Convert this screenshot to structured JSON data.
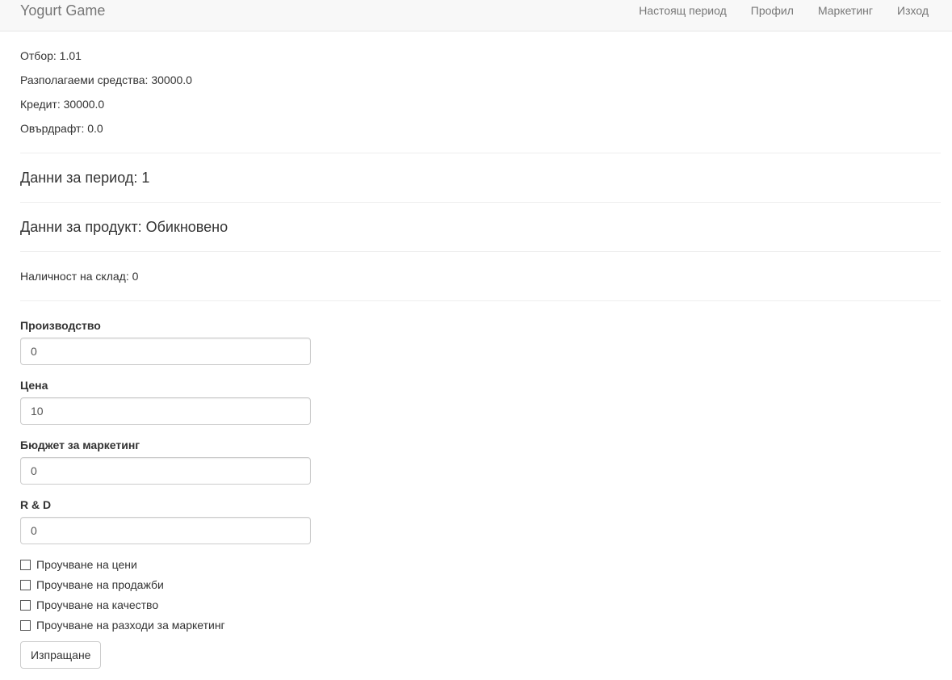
{
  "navbar": {
    "brand": "Yogurt Game",
    "links": [
      "Настоящ период",
      "Профил",
      "Маркетинг",
      "Изход"
    ]
  },
  "team_info": {
    "team": "Отбор: 1.01",
    "funds": "Разполагаеми средства: 30000.0",
    "credit": "Кредит: 30000.0",
    "overdraft": "Овърдрафт: 0.0"
  },
  "period_heading": "Данни за период: 1",
  "product_heading": "Данни за продукт: Обикновено",
  "stock": "Наличност на склад: 0",
  "form": {
    "production_label": "Производство",
    "production_value": "0",
    "price_label": "Цена",
    "price_value": "10",
    "marketing_label": "Бюджет за маркетинг",
    "marketing_value": "0",
    "rd_label": "R & D",
    "rd_value": "0",
    "checkboxes": [
      "Проучване на цени",
      "Проучване на продажби",
      "Проучване на качество",
      "Проучване на разходи за маркетинг"
    ],
    "submit_label": "Изпращане"
  }
}
